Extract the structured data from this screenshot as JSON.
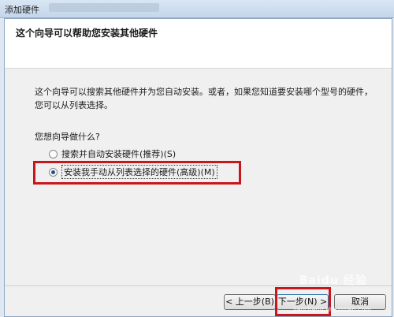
{
  "window": {
    "title": "添加硬件"
  },
  "wizard": {
    "heading": "这个向导可以帮助您安装其他硬件",
    "description": "这个向导可以搜索其他硬件并为您自动安装。或者，如果您知道要安装哪个型号的硬件，您可以从列表选择。",
    "question": "您想向导做什么?",
    "options": [
      {
        "label": "搜索并自动安装硬件(推荐)(S)",
        "checked": false
      },
      {
        "label": "安装我手动从列表选择的硬件(高级)(M)",
        "checked": true
      }
    ]
  },
  "footer": {
    "back_label": "< 上一步(B)",
    "next_label": "下一步(N) >",
    "cancel_label": "取消"
  },
  "watermark": {
    "text": "Baidu 经验",
    "url": "jiaocheng.chazidian.com"
  },
  "colors": {
    "highlight": "#c8161d",
    "header_bg": "#ffffff",
    "dialog_bg": "#f0f0f0"
  }
}
